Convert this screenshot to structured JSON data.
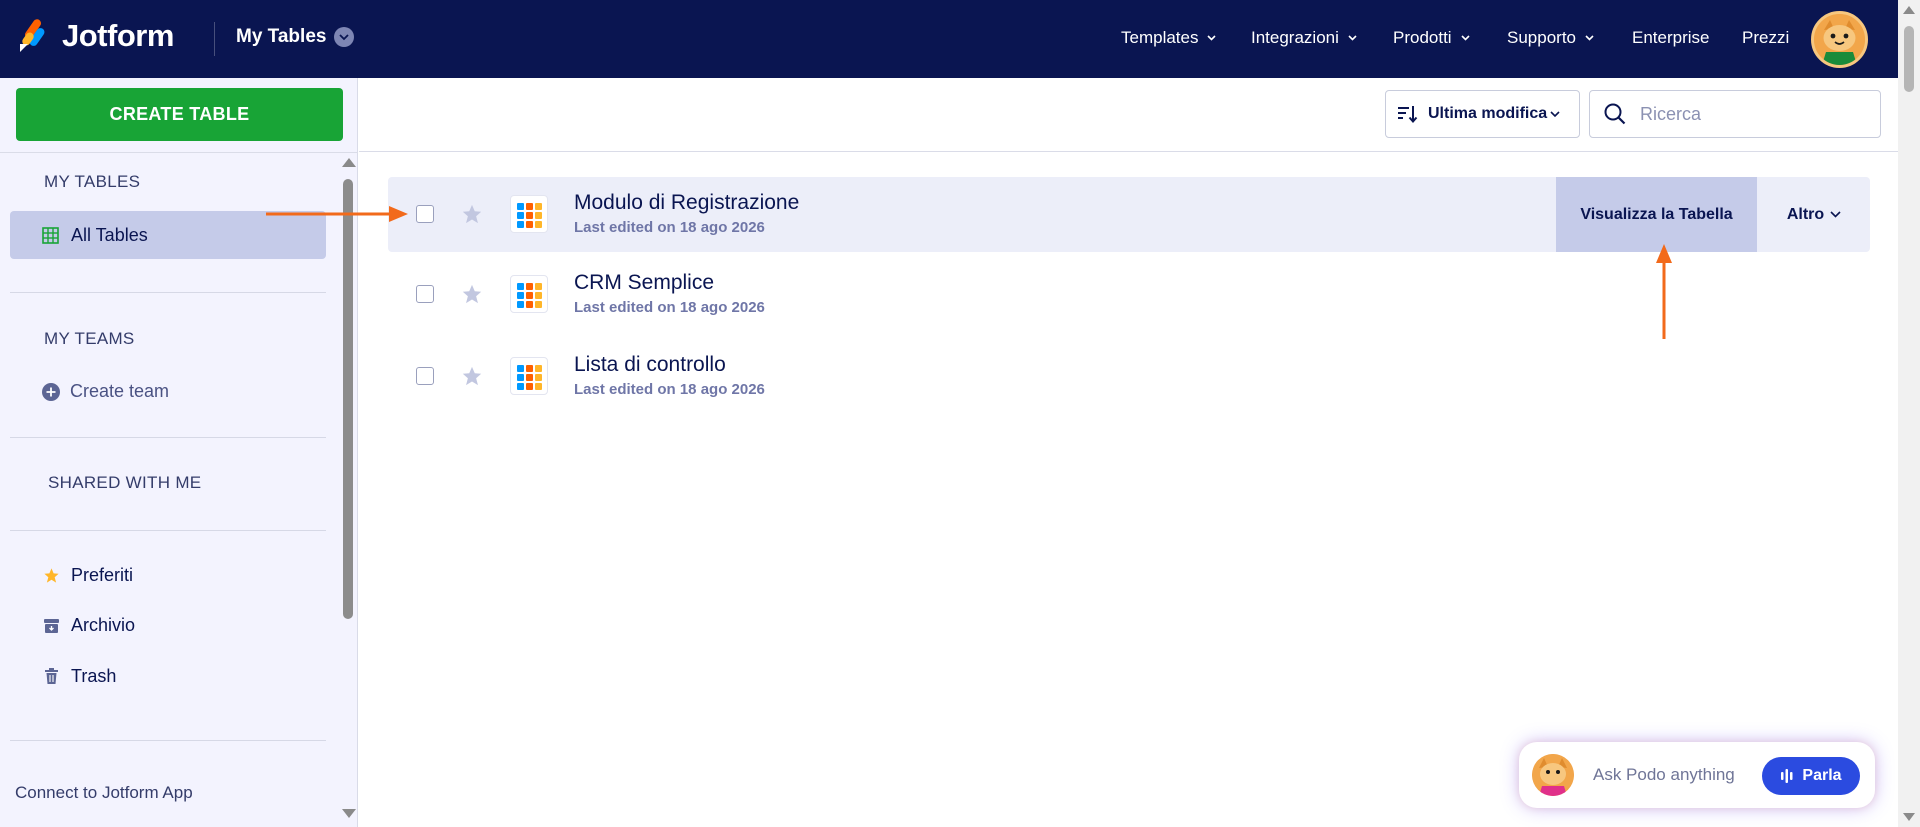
{
  "header": {
    "brand": "Jotform",
    "section_title": "My Tables",
    "nav": [
      {
        "label": "Templates",
        "has_caret": true
      },
      {
        "label": "Integrazioni",
        "has_caret": true
      },
      {
        "label": "Prodotti",
        "has_caret": true
      },
      {
        "label": "Supporto",
        "has_caret": true
      },
      {
        "label": "Enterprise",
        "has_caret": false
      },
      {
        "label": "Prezzi",
        "has_caret": false
      }
    ]
  },
  "sidebar": {
    "create_button": "CREATE TABLE",
    "my_tables_heading": "MY TABLES",
    "all_tables": "All Tables",
    "my_teams_heading": "MY TEAMS",
    "create_team": "Create team",
    "shared_heading": "SHARED WITH ME",
    "items": [
      {
        "label": "Preferiti",
        "icon": "star-icon"
      },
      {
        "label": "Archivio",
        "icon": "archive-icon"
      },
      {
        "label": "Trash",
        "icon": "trash-icon"
      }
    ],
    "connect": "Connect to Jotform App"
  },
  "toolbar": {
    "sort_label": "Ultima modifica",
    "search_placeholder": "Ricerca"
  },
  "tables": [
    {
      "title": "Modulo di Registrazione",
      "subtitle": "Last edited on 18 ago 2026",
      "active": true
    },
    {
      "title": "CRM Semplice",
      "subtitle": "Last edited on 18 ago 2026",
      "active": false
    },
    {
      "title": "Lista di controllo",
      "subtitle": "Last edited on 18 ago 2026",
      "active": false
    }
  ],
  "row_actions": {
    "view": "Visualizza la Tabella",
    "more": "Altro"
  },
  "podo": {
    "placeholder": "Ask Podo anything",
    "button": "Parla"
  },
  "colors": {
    "topbar": "#0a1551",
    "create_button": "#18a436",
    "selected": "#c5cbe9",
    "annotation_arrow": "#f26a1b",
    "parla_button": "#2b4be0"
  }
}
